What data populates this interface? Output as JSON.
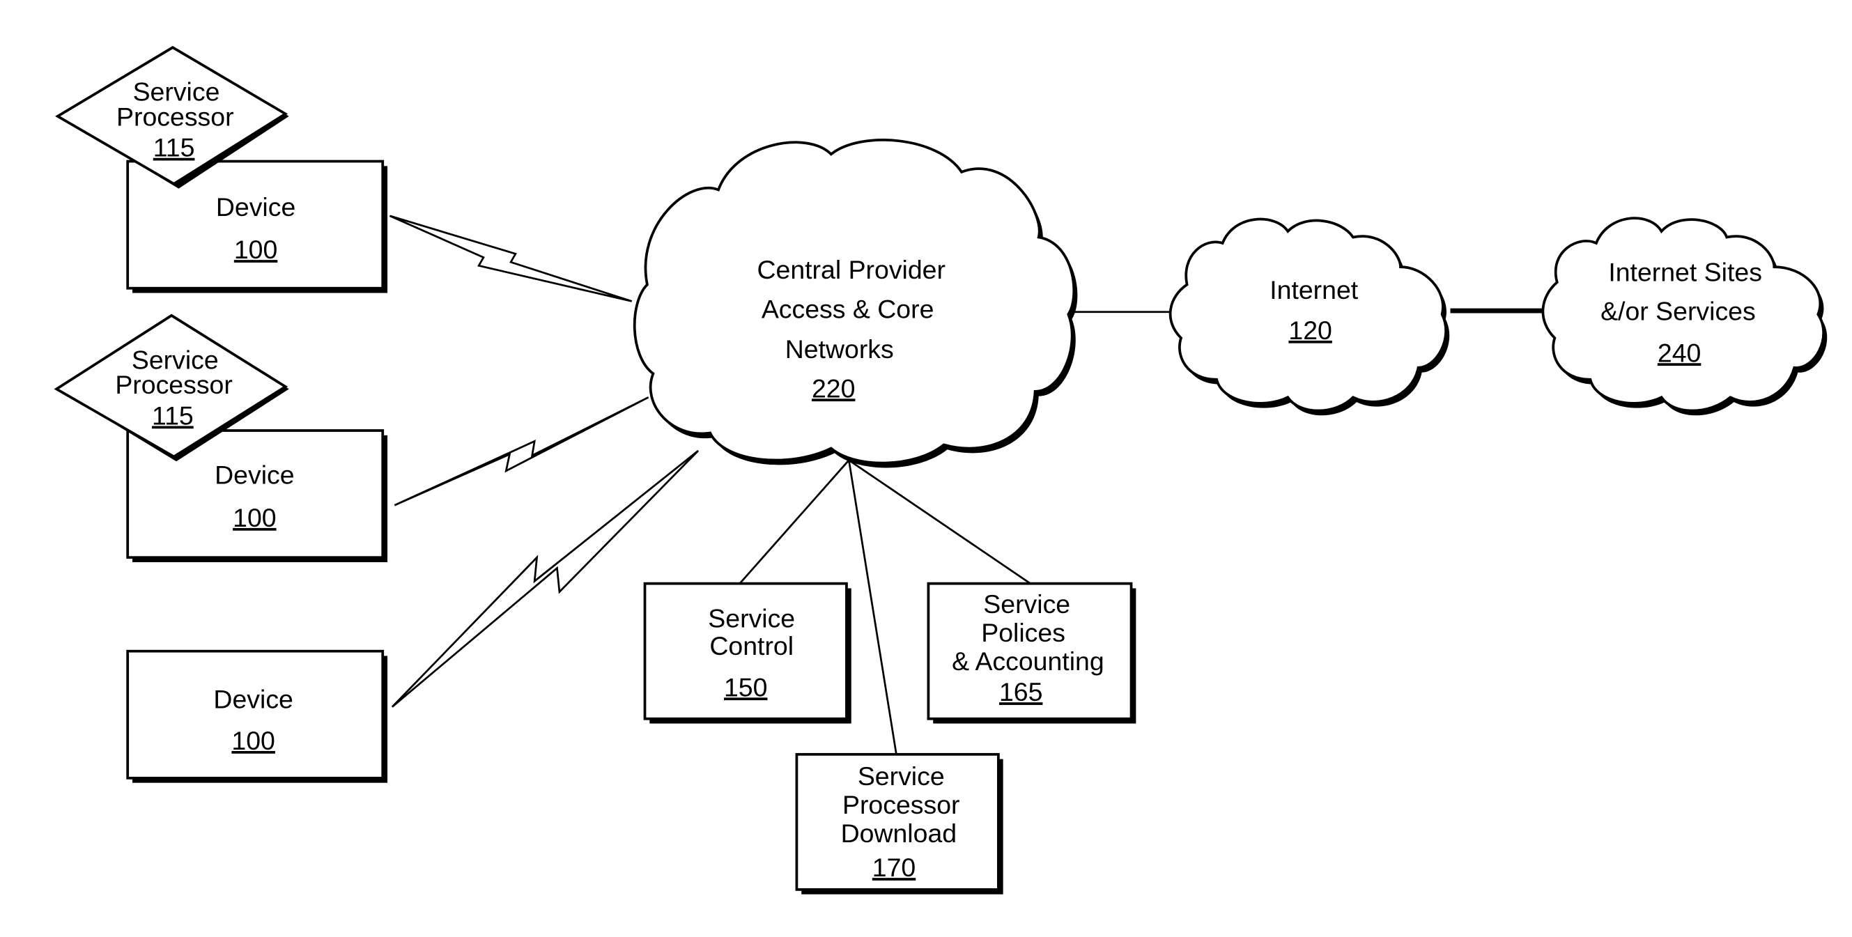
{
  "diagram": {
    "devices": [
      {
        "label": "Device",
        "ref": "100",
        "has_service_processor": true
      },
      {
        "label": "Device",
        "ref": "100",
        "has_service_processor": true
      },
      {
        "label": "Device",
        "ref": "100",
        "has_service_processor": false
      }
    ],
    "service_processor": {
      "line1": "Service",
      "line2": "Processor",
      "ref": "115"
    },
    "core_network": {
      "line1": "Central Provider",
      "line2": "Access & Core",
      "line3": "Networks",
      "ref": "220"
    },
    "internet": {
      "line1": "Internet",
      "ref": "120"
    },
    "internet_sites": {
      "line1": "Internet Sites",
      "line2": "&/or Services",
      "ref": "240"
    },
    "service_control": {
      "line1": "Service",
      "line2": "Control",
      "ref": "150"
    },
    "service_policies": {
      "line1": "Service",
      "line2": "Polices",
      "line3": "& Accounting",
      "ref": "165"
    },
    "sp_download": {
      "line1": "Service",
      "line2": "Processor",
      "line3": "Download",
      "ref": "170"
    }
  }
}
